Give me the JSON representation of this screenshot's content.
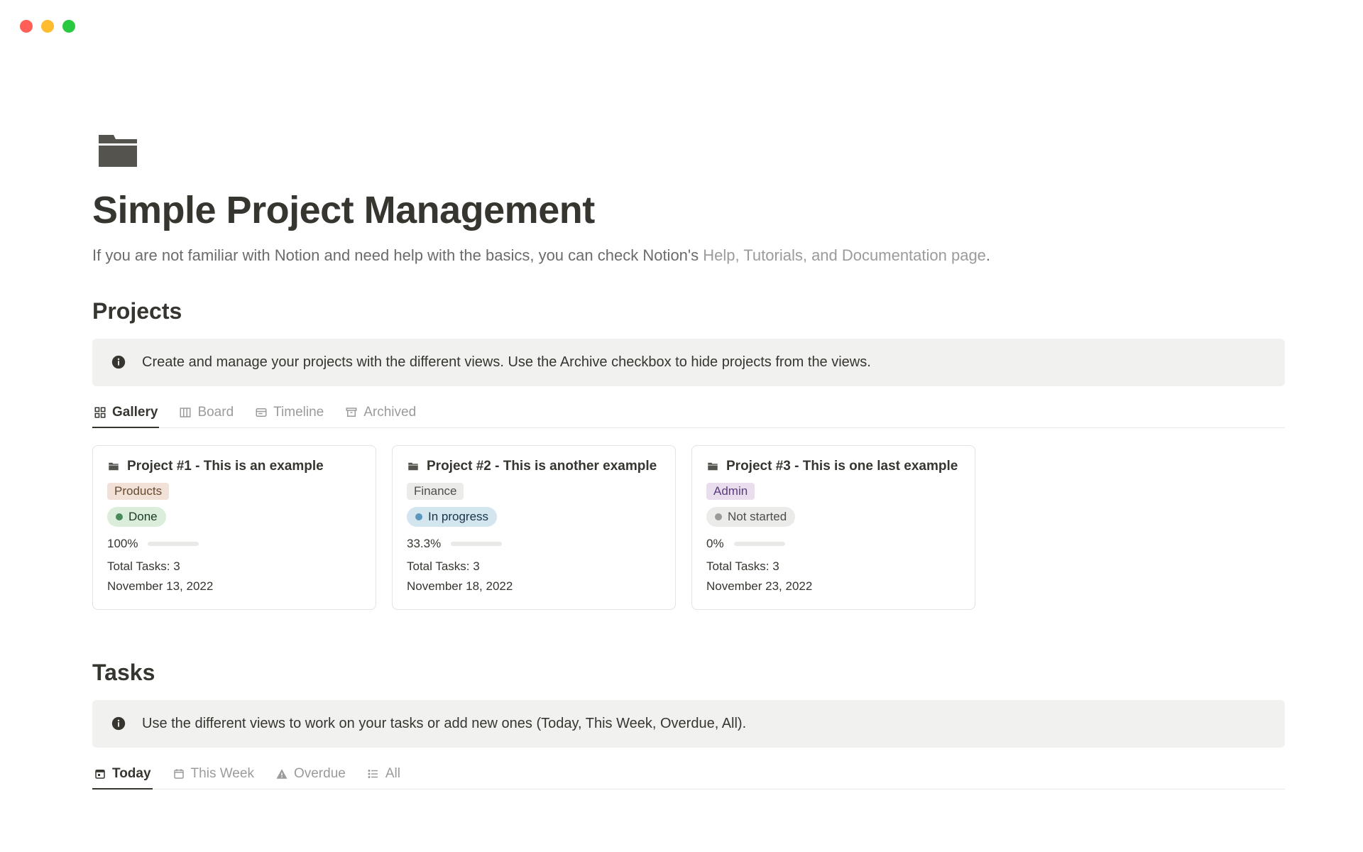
{
  "header": {
    "title": "Simple Project Management",
    "intro_prefix": "If you are not familiar with Notion and need help with the basics, you can check Notion's ",
    "intro_link": "Help, Tutorials, and Documentation page",
    "intro_suffix": "."
  },
  "projects": {
    "heading": "Projects",
    "callout": "Create and manage your projects with the different views. Use the Archive checkbox to hide projects from the views.",
    "tabs": [
      {
        "label": "Gallery",
        "icon": "gallery-icon",
        "active": true
      },
      {
        "label": "Board",
        "icon": "board-icon",
        "active": false
      },
      {
        "label": "Timeline",
        "icon": "timeline-icon",
        "active": false
      },
      {
        "label": "Archived",
        "icon": "archive-icon",
        "active": false
      }
    ],
    "cards": [
      {
        "title": "Project #1 - This is an example",
        "tag": {
          "label": "Products",
          "class": "tag-products"
        },
        "status": {
          "label": "Done",
          "class": "status-done",
          "dot": "dot-done"
        },
        "progress": {
          "text": "100%",
          "pct": 100
        },
        "total": "Total Tasks: 3",
        "date": "November 13, 2022"
      },
      {
        "title": "Project #2 - This is another example",
        "tag": {
          "label": "Finance",
          "class": "tag-finance"
        },
        "status": {
          "label": "In progress",
          "class": "status-inprog",
          "dot": "dot-blue"
        },
        "progress": {
          "text": "33.3%",
          "pct": 33.3
        },
        "total": "Total Tasks: 3",
        "date": "November 18, 2022"
      },
      {
        "title": "Project #3 - This is one last example",
        "tag": {
          "label": "Admin",
          "class": "tag-admin"
        },
        "status": {
          "label": "Not started",
          "class": "status-notst",
          "dot": "dot-gray"
        },
        "progress": {
          "text": "0%",
          "pct": 0
        },
        "total": "Total Tasks: 3",
        "date": "November 23, 2022"
      }
    ]
  },
  "tasks": {
    "heading": "Tasks",
    "callout": "Use the different views to work on your tasks or add new ones (Today, This Week, Overdue, All).",
    "tabs": [
      {
        "label": "Today",
        "icon": "calendar-today-icon",
        "active": true
      },
      {
        "label": "This Week",
        "icon": "calendar-week-icon",
        "active": false
      },
      {
        "label": "Overdue",
        "icon": "warning-icon",
        "active": false
      },
      {
        "label": "All",
        "icon": "list-icon",
        "active": false
      }
    ]
  }
}
